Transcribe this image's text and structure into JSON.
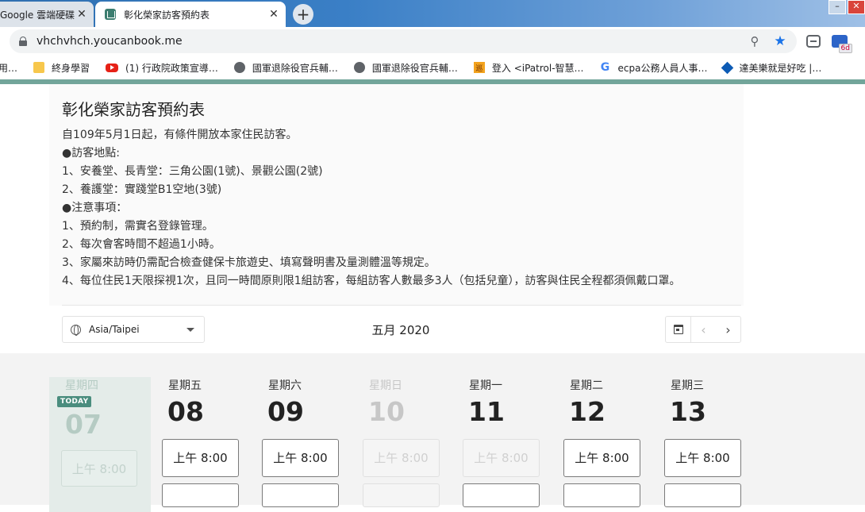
{
  "browser": {
    "tabs": [
      {
        "title": "Google 雲端硬碟",
        "active": false
      },
      {
        "title": "彰化榮家訪客預約表",
        "active": true
      }
    ],
    "url": "vhchvhch.youcanbook.me",
    "extension_badge": "6d",
    "bookmarks": [
      {
        "label": "用…",
        "icon": "none"
      },
      {
        "label": "終身學習",
        "icon": "folder-icon"
      },
      {
        "label": "(1) 行政院政策宣導…",
        "icon": "youtube-icon"
      },
      {
        "label": "國軍退除役官兵輔…",
        "icon": "globe-icon"
      },
      {
        "label": "國軍退除役官兵輔…",
        "icon": "globe-icon"
      },
      {
        "label": "登入 <iPatrol-智慧…",
        "icon": "patrol-icon"
      },
      {
        "label": "ecpa公務人員人事…",
        "icon": "google-icon"
      },
      {
        "label": "達美樂就是好吃 |…",
        "icon": "dominos-icon"
      }
    ]
  },
  "intro": {
    "title": "彰化榮家訪客預約表",
    "lines": [
      "自109年5月1日起，有條件開放本家住民訪客。",
      "●訪客地點:",
      "1、安養堂、長青堂：三角公園(1號)、景觀公園(2號)",
      "2、養護堂：實踐堂B1空地(3號)",
      "●注意事項：",
      "1、預約制，需實名登錄管理。",
      "2、每次會客時間不超過1小時。",
      "3、家屬來訪時仍需配合檢查健保卡旅遊史、填寫聲明書及量測體溫等規定。",
      "4、每位住民1天限探視1次，且同一時間原則限1組訪客，每組訪客人數最多3人（包括兒童），訪客與住民全程都須佩戴口罩。"
    ]
  },
  "calendar": {
    "timezone": "Asia/Taipei",
    "month": "五月 2020",
    "today_label": "TODAY",
    "days": [
      {
        "weekday": "星期四",
        "date": "07",
        "today": true,
        "available": false,
        "slot": "上午 8:00"
      },
      {
        "weekday": "星期五",
        "date": "08",
        "today": false,
        "available": true,
        "slot": "上午 8:00"
      },
      {
        "weekday": "星期六",
        "date": "09",
        "today": false,
        "available": true,
        "slot": "上午 8:00"
      },
      {
        "weekday": "星期日",
        "date": "10",
        "today": false,
        "available": false,
        "slot": "上午 8:00"
      },
      {
        "weekday": "星期一",
        "date": "11",
        "today": false,
        "available": false,
        "slot": "上午 8:00"
      },
      {
        "weekday": "星期二",
        "date": "12",
        "today": false,
        "available": true,
        "slot": "上午 8:00"
      },
      {
        "weekday": "星期三",
        "date": "13",
        "today": false,
        "available": true,
        "slot": "上午 8:00"
      }
    ]
  },
  "colors": {
    "accent": "#72a59a",
    "today": "#4a8d7e",
    "link": "#1a73e8"
  }
}
